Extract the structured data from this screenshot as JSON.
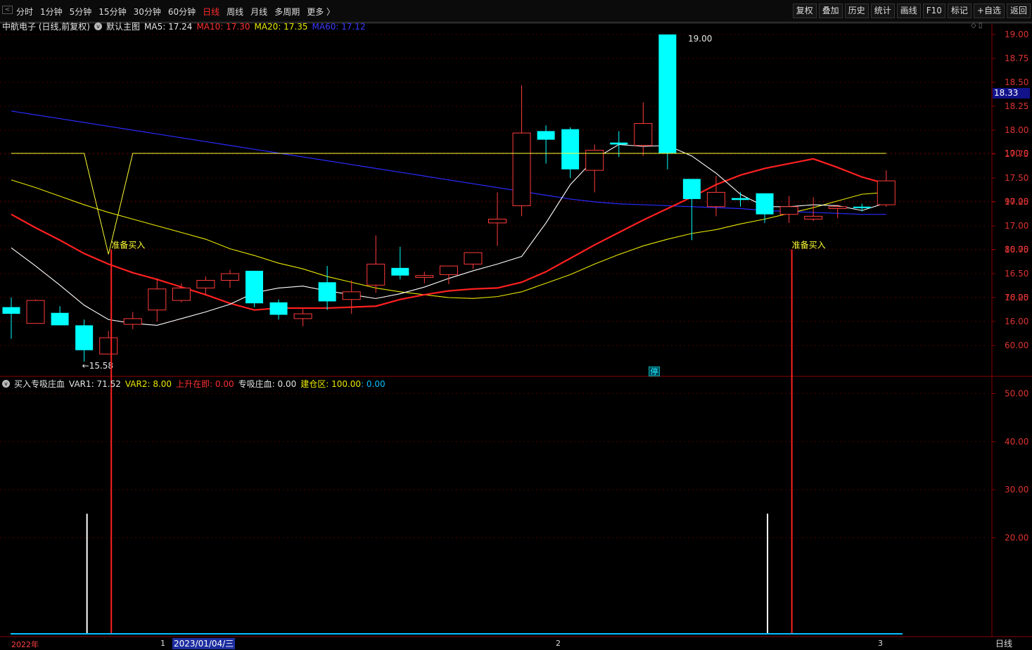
{
  "nav": {
    "back": "<",
    "periods": [
      "分时",
      "1分钟",
      "5分钟",
      "15分钟",
      "30分钟",
      "60分钟",
      "日线",
      "周线",
      "月线",
      "多周期",
      "更多 〉"
    ],
    "active": "日线"
  },
  "toolbar": [
    "复权",
    "叠加",
    "历史",
    "统计",
    "画线",
    "F10",
    "标记",
    "+自选",
    "返回"
  ],
  "price_panel": {
    "title": "中航电子 (日线,前复权)",
    "main_chart": "默认主图",
    "ma5_label": "MA5: 17.24",
    "ma10_label": "MA10: 17.30",
    "ma20_label": "MA20: 17.35",
    "ma60_label": "MA60: 17.12",
    "high_label": "19.00",
    "low_label": "←15.58",
    "last_price": "18.33",
    "limit_marker": "停",
    "y_ticks": [
      "19.00",
      "18.75",
      "18.50",
      "18.25",
      "18.00",
      "17.75",
      "17.50",
      "17.25",
      "17.00",
      "16.75",
      "16.50",
      "16.25",
      "16.00"
    ]
  },
  "indicator_panel": {
    "name": "买入专吸庄血",
    "var1": "VAR1: 71.52",
    "var2": "VAR2: 8.00",
    "up": "上升在即: 0.00",
    "absorb": "专吸庄血: 0.00",
    "build": "建仓区: 100.00",
    "build2": ": 0.00",
    "signal_label": "准备买入",
    "y_ticks": [
      "100.0",
      "90.00",
      "80.00",
      "70.00",
      "60.00",
      "50.00",
      "40.00",
      "30.00",
      "20.00"
    ]
  },
  "x_axis": {
    "year": "2022年",
    "m1": "1",
    "date": "2023/01/04/三",
    "m2": "2",
    "m3": "3",
    "period_btn": "日线"
  },
  "colors": {
    "up": "#ff3b3b",
    "down": "#00ffff",
    "ma5": "#ffffff",
    "ma10": "#ff2020",
    "ma20": "#e8e800",
    "ma60": "#2a2aff",
    "axis": "#8b0000",
    "signal": "#ffff33"
  },
  "chart_data": {
    "type": "candlestick",
    "candles": [
      {
        "o": 16.15,
        "h": 16.25,
        "l": 15.82,
        "c": 16.08
      },
      {
        "o": 15.98,
        "h": 16.23,
        "l": 15.98,
        "c": 16.22
      },
      {
        "o": 16.09,
        "h": 16.16,
        "l": 15.98,
        "c": 15.96
      },
      {
        "o": 15.96,
        "h": 16.02,
        "l": 15.58,
        "c": 15.7
      },
      {
        "o": 15.66,
        "h": 15.9,
        "l": 15.66,
        "c": 15.83
      },
      {
        "o": 15.97,
        "h": 16.1,
        "l": 15.92,
        "c": 16.03
      },
      {
        "o": 16.12,
        "h": 16.45,
        "l": 16.0,
        "c": 16.34
      },
      {
        "o": 16.22,
        "h": 16.4,
        "l": 16.2,
        "c": 16.35
      },
      {
        "o": 16.35,
        "h": 16.47,
        "l": 16.27,
        "c": 16.43
      },
      {
        "o": 16.43,
        "h": 16.54,
        "l": 16.35,
        "c": 16.5
      },
      {
        "o": 16.53,
        "h": 16.53,
        "l": 16.15,
        "c": 16.19
      },
      {
        "o": 16.2,
        "h": 16.23,
        "l": 16.02,
        "c": 16.07
      },
      {
        "o": 16.03,
        "h": 16.13,
        "l": 15.95,
        "c": 16.08
      },
      {
        "o": 16.41,
        "h": 16.58,
        "l": 16.12,
        "c": 16.21
      },
      {
        "o": 16.23,
        "h": 16.43,
        "l": 16.08,
        "c": 16.31
      },
      {
        "o": 16.38,
        "h": 16.9,
        "l": 16.3,
        "c": 16.6
      },
      {
        "o": 16.56,
        "h": 16.78,
        "l": 16.44,
        "c": 16.48
      },
      {
        "o": 16.46,
        "h": 16.52,
        "l": 16.4,
        "c": 16.48
      },
      {
        "o": 16.49,
        "h": 16.58,
        "l": 16.39,
        "c": 16.58
      },
      {
        "o": 16.6,
        "h": 16.72,
        "l": 16.55,
        "c": 16.72
      },
      {
        "o": 17.03,
        "h": 17.35,
        "l": 16.79,
        "c": 17.07
      },
      {
        "o": 17.21,
        "h": 18.47,
        "l": 17.1,
        "c": 17.97
      },
      {
        "o": 17.99,
        "h": 18.05,
        "l": 17.65,
        "c": 17.9
      },
      {
        "o": 18.01,
        "h": 18.03,
        "l": 17.5,
        "c": 17.59
      },
      {
        "o": 17.58,
        "h": 17.85,
        "l": 17.35,
        "c": 17.79
      },
      {
        "o": 17.87,
        "h": 17.99,
        "l": 17.72,
        "c": 17.85
      },
      {
        "o": 17.84,
        "h": 18.29,
        "l": 17.73,
        "c": 18.07
      },
      {
        "o": 19.0,
        "h": 19.0,
        "l": 17.59,
        "c": 17.76
      },
      {
        "o": 17.49,
        "h": 17.49,
        "l": 16.85,
        "c": 17.28
      },
      {
        "o": 17.2,
        "h": 17.52,
        "l": 17.1,
        "c": 17.35
      },
      {
        "o": 17.29,
        "h": 17.35,
        "l": 17.2,
        "c": 17.27
      },
      {
        "o": 17.34,
        "h": 17.34,
        "l": 17.03,
        "c": 17.12
      },
      {
        "o": 17.12,
        "h": 17.31,
        "l": 17.03,
        "c": 17.2
      },
      {
        "o": 17.07,
        "h": 17.3,
        "l": 17.05,
        "c": 17.1
      },
      {
        "o": 17.18,
        "h": 17.22,
        "l": 17.08,
        "c": 17.2
      },
      {
        "o": 17.2,
        "h": 17.23,
        "l": 17.15,
        "c": 17.19
      },
      {
        "o": 17.22,
        "h": 17.58,
        "l": 17.2,
        "c": 17.47
      }
    ],
    "ma5": [
      16.77,
      16.58,
      16.38,
      16.17,
      16.02,
      15.98,
      15.96,
      16.03,
      16.1,
      16.18,
      16.3,
      16.35,
      16.37,
      16.32,
      16.28,
      16.24,
      16.29,
      16.36,
      16.45,
      16.53,
      16.6,
      16.68,
      17.03,
      17.43,
      17.7,
      17.85,
      17.83,
      17.84,
      17.73,
      17.55,
      17.33,
      17.2,
      17.2,
      17.22,
      17.21,
      17.16,
      17.24
    ],
    "ma10": [
      17.12,
      16.98,
      16.85,
      16.71,
      16.6,
      16.51,
      16.44,
      16.36,
      16.28,
      16.19,
      16.12,
      16.14,
      16.14,
      16.14,
      16.15,
      16.16,
      16.23,
      16.28,
      16.32,
      16.34,
      16.35,
      16.41,
      16.52,
      16.66,
      16.8,
      16.93,
      17.06,
      17.18,
      17.3,
      17.43,
      17.53,
      17.6,
      17.65,
      17.7,
      17.61,
      17.51,
      17.44
    ],
    "ma20": [
      17.48,
      17.4,
      17.31,
      17.22,
      17.14,
      17.07,
      17.0,
      16.93,
      16.86,
      16.76,
      16.69,
      16.61,
      16.55,
      16.47,
      16.41,
      16.35,
      16.31,
      16.28,
      16.25,
      16.24,
      16.26,
      16.31,
      16.4,
      16.49,
      16.6,
      16.7,
      16.79,
      16.86,
      16.92,
      16.96,
      17.02,
      17.07,
      17.13,
      17.19,
      17.26,
      17.33,
      17.35
    ],
    "ma60": [
      18.2,
      18.16,
      18.12,
      18.08,
      18.04,
      18.0,
      17.96,
      17.92,
      17.88,
      17.84,
      17.8,
      17.76,
      17.72,
      17.68,
      17.64,
      17.6,
      17.56,
      17.52,
      17.48,
      17.44,
      17.4,
      17.36,
      17.32,
      17.28,
      17.25,
      17.23,
      17.22,
      17.21,
      17.2,
      17.19,
      17.18,
      17.16,
      17.15,
      17.14,
      17.13,
      17.12,
      17.12
    ],
    "indicator": {
      "build_zone": [
        100,
        100,
        100,
        100,
        79,
        100,
        100,
        100,
        100,
        100,
        100,
        100,
        100,
        100,
        100,
        100,
        100,
        100,
        100,
        100,
        100,
        100,
        100,
        100,
        100,
        100,
        100,
        100,
        100,
        100,
        100,
        100,
        100,
        100,
        100,
        100,
        100
      ],
      "var2_bars": [
        {
          "i": 3,
          "v": 25
        },
        {
          "i": 31,
          "v": 25
        }
      ],
      "buy_signals": [
        {
          "i": 4,
          "v": 80
        },
        {
          "i": 32,
          "v": 80
        }
      ],
      "ylim": [
        0,
        100
      ]
    },
    "price_ylim": [
      15.4,
      19.1
    ]
  }
}
